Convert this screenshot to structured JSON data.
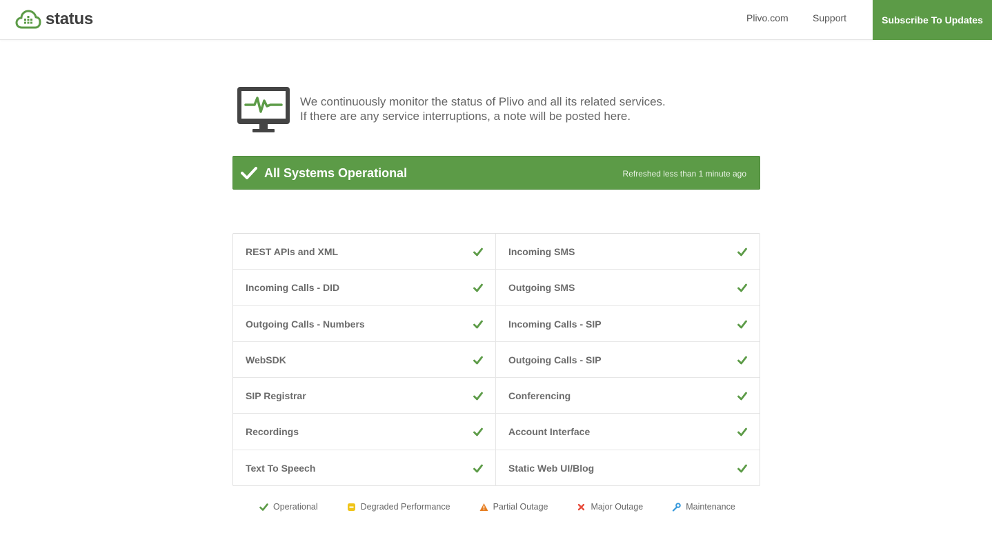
{
  "header": {
    "logo_text": "status",
    "nav": {
      "plivo": "Plivo.com",
      "support": "Support"
    },
    "subscribe_label": "Subscribe To Updates"
  },
  "intro": {
    "line1": "We continuously monitor the status of Plivo and all its related services.",
    "line2": "If there are any service interruptions, a note will be posted here."
  },
  "status_bar": {
    "title": "All Systems Operational",
    "refreshed": "Refreshed less than 1 minute ago"
  },
  "components": [
    {
      "name": "REST APIs and XML",
      "status": "operational"
    },
    {
      "name": "Incoming SMS",
      "status": "operational"
    },
    {
      "name": "Incoming Calls - DID",
      "status": "operational"
    },
    {
      "name": "Outgoing SMS",
      "status": "operational"
    },
    {
      "name": "Outgoing Calls - Numbers",
      "status": "operational"
    },
    {
      "name": "Incoming Calls - SIP",
      "status": "operational"
    },
    {
      "name": "WebSDK",
      "status": "operational"
    },
    {
      "name": "Outgoing Calls - SIP",
      "status": "operational"
    },
    {
      "name": "SIP Registrar",
      "status": "operational"
    },
    {
      "name": "Conferencing",
      "status": "operational"
    },
    {
      "name": "Recordings",
      "status": "operational"
    },
    {
      "name": "Account Interface",
      "status": "operational"
    },
    {
      "name": "Text To Speech",
      "status": "operational"
    },
    {
      "name": "Static Web UI/Blog",
      "status": "operational"
    }
  ],
  "legend": [
    {
      "label": "Operational",
      "icon": "check-icon",
      "color": "#5c9b47"
    },
    {
      "label": "Degraded Performance",
      "icon": "minus-square-icon",
      "color": "#f0c419"
    },
    {
      "label": "Partial Outage",
      "icon": "warning-icon",
      "color": "#e67e22"
    },
    {
      "label": "Major Outage",
      "icon": "x-icon",
      "color": "#e74c3c"
    },
    {
      "label": "Maintenance",
      "icon": "wrench-icon",
      "color": "#3498db"
    }
  ],
  "colors": {
    "accent": "#5c9b47",
    "text": "#555555",
    "border": "#e0e0e0"
  }
}
